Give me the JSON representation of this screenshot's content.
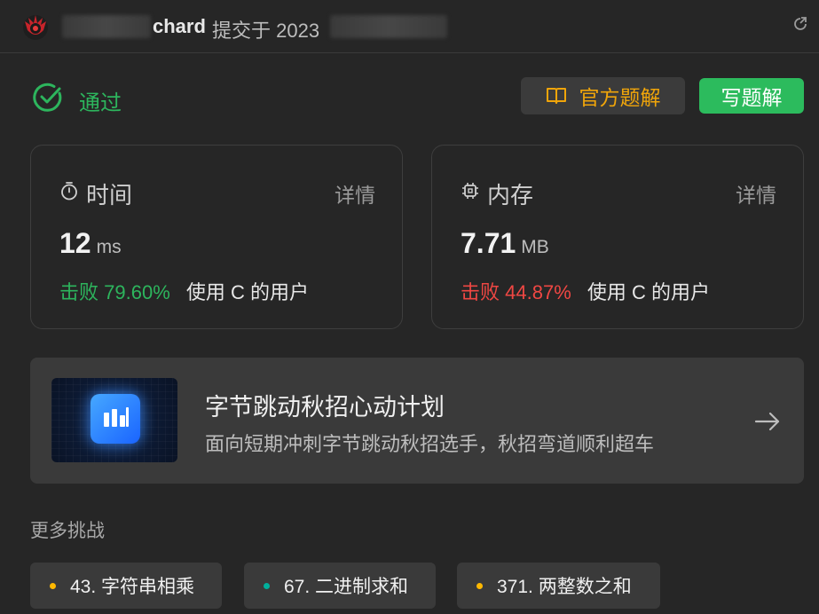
{
  "header": {
    "author": "chard",
    "submitted_text": "提交于 2023"
  },
  "status": {
    "label": "通过",
    "color": "#2db55d"
  },
  "actions": {
    "official_solution_label": "官方题解",
    "write_solution_label": "写题解"
  },
  "metrics": {
    "time": {
      "title": "时间",
      "detail_label": "详情",
      "value": "12",
      "unit": "ms",
      "beat_label": "击败",
      "beat_pct": "79.60%",
      "beat_suffix": "使用 C 的用户",
      "beat_color": "#2db55d"
    },
    "memory": {
      "title": "内存",
      "detail_label": "详情",
      "value": "7.71",
      "unit": "MB",
      "beat_label": "击败",
      "beat_pct": "44.87%",
      "beat_suffix": "使用 C 的用户",
      "beat_color": "#ef4743"
    }
  },
  "promo": {
    "title": "字节跳动秋招心动计划",
    "subtitle": "面向短期冲刺字节跳动秋招选手，秋招弯道顺利超车"
  },
  "more": {
    "title": "更多挑战",
    "items": [
      {
        "label": "43. 字符串相乘",
        "color": "#ffb800"
      },
      {
        "label": "67. 二进制求和",
        "color": "#00af9b"
      },
      {
        "label": "371. 两整数之和",
        "color": "#ffb800"
      }
    ]
  },
  "icons": {
    "avatar": "avatar-icon",
    "refresh": "external-link-icon",
    "status": "check-circle-icon",
    "book": "book-icon",
    "timer": "timer-icon",
    "chip": "chip-icon",
    "arrow": "arrow-right-icon"
  }
}
